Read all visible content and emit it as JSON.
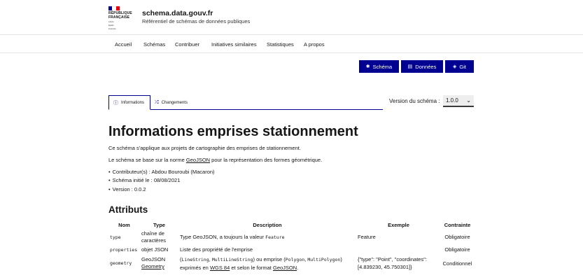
{
  "header": {
    "republic_line1": "RÉPUBLIQUE",
    "republic_line2": "FRANÇAISE",
    "devise1": "Liberté",
    "devise2": "Égalité",
    "devise3": "Fraternité",
    "site_title": "schema.data.gouv.fr",
    "site_tagline": "Référentiel de schémas de données publiques",
    "flag_colors": [
      "#000091",
      "#ffffff",
      "#e1000f"
    ]
  },
  "nav": [
    "Accueil",
    "Schémas",
    "Contribuer",
    "Initiatives similaires",
    "Statistiques",
    "A propos"
  ],
  "actions": {
    "schema": "Schéma",
    "donnees": "Données",
    "git": "Git"
  },
  "tabs": {
    "informations": "Informations",
    "changements": "Changements"
  },
  "version": {
    "label": "Version du schéma :",
    "selected": "1.0.0"
  },
  "title": "Informations emprises stationnement",
  "intro1": "Ce schéma s'applique aux projets de cartographie des emprises de stationnement.",
  "intro2": {
    "before": "Le schéma se base sur la norme ",
    "link": "GeoJSON",
    "after": " pour la représentation des formes géométrique."
  },
  "meta": [
    "Contributeur(s) : Abdou Bouroubi (Macaron)",
    "Schéma initié le : 08/08/2021",
    "Version : 0.0.2"
  ],
  "attributes": {
    "heading": "Attributs",
    "columns": [
      "Nom",
      "Type",
      "Description",
      "Exemple",
      "Contrainte"
    ],
    "rows": [
      {
        "name": "type",
        "type_a": "chaîne de",
        "type_b": "caractères",
        "desc_a": "Type GeoJSON, a toujours la valeur ",
        "desc_code": "Feature",
        "example": "Feature",
        "constraint": "Obligatoire"
      },
      {
        "name": "properties",
        "type_a": "objet JSON",
        "desc_a": "Liste des propriété de l'emprise",
        "example": "",
        "constraint": "Obligatoire"
      },
      {
        "name": "geometry",
        "type_a": "GeoJSON",
        "type_b": "Geometry",
        "desc_l1_a": "(",
        "desc_l1_c1": "LineString",
        "desc_l1_b": ", ",
        "desc_l1_c2": "MultiLineString",
        "desc_l1_c": ") ou emprise (",
        "desc_l1_c3": "Polygon",
        "desc_l1_d": ", ",
        "desc_l1_c4": "MultiPolygon",
        "desc_l1_e": ")",
        "desc_l2_a": "exprimés en ",
        "desc_l2_link1": "WGS 84",
        "desc_l2_b": " et selon le format ",
        "desc_l2_link2": "GeoJSON",
        "desc_l2_c": ".",
        "example_l1": "{\"type\": \"Point\", \"coordinates\":",
        "example_l2": "[4.839230, 45.750301]}",
        "constraint": "Conditionnel"
      }
    ]
  }
}
